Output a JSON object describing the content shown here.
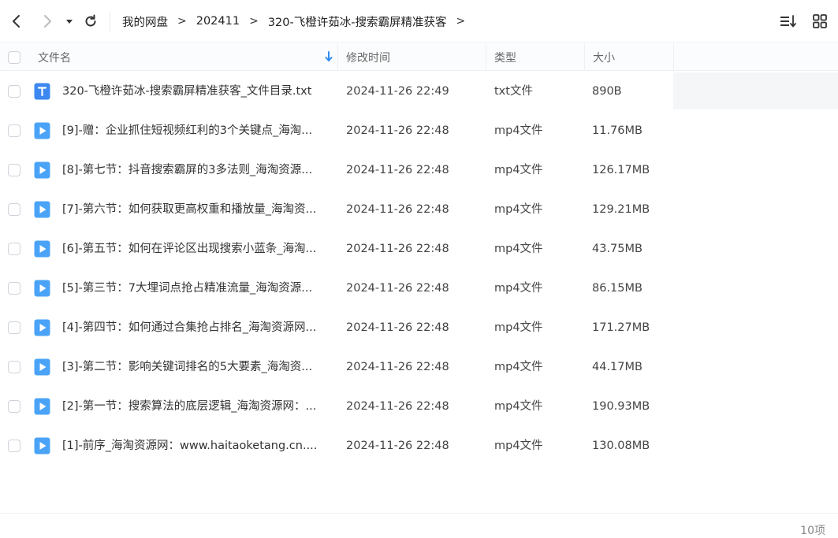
{
  "toolbar": {
    "breadcrumb": [
      "我的网盘",
      "202411",
      "320-飞橙许茹冰-搜索霸屏精准获客"
    ],
    "icons": [
      "back-arrow-icon",
      "forward-arrow-icon",
      "dropdown-caret-icon",
      "refresh-icon",
      "sort-list-icon",
      "grid-view-icon"
    ]
  },
  "header": {
    "name": "文件名",
    "time": "修改时间",
    "type": "类型",
    "size": "大小"
  },
  "files": [
    {
      "name": "320-飞橙许茹冰-搜索霸屏精准获客_文件目录.txt",
      "time": "2024-11-26 22:49",
      "type": "txt文件",
      "size": "890B",
      "icon": "txt-file-icon"
    },
    {
      "name": "[9]-赠：企业抓住短视频红利的3个关键点_海淘...",
      "time": "2024-11-26 22:48",
      "type": "mp4文件",
      "size": "11.76MB",
      "icon": "video-file-icon"
    },
    {
      "name": "[8]-第七节：抖音搜索霸屏的3多法则_海淘资源...",
      "time": "2024-11-26 22:48",
      "type": "mp4文件",
      "size": "126.17MB",
      "icon": "video-file-icon"
    },
    {
      "name": "[7]-第六节：如何获取更高权重和播放量_海淘资...",
      "time": "2024-11-26 22:48",
      "type": "mp4文件",
      "size": "129.21MB",
      "icon": "video-file-icon"
    },
    {
      "name": "[6]-第五节：如何在评论区出现搜索小蓝条_海淘...",
      "time": "2024-11-26 22:48",
      "type": "mp4文件",
      "size": "43.75MB",
      "icon": "video-file-icon"
    },
    {
      "name": "[5]-第三节：7大埋词点抢占精准流量_海淘资源...",
      "time": "2024-11-26 22:48",
      "type": "mp4文件",
      "size": "86.15MB",
      "icon": "video-file-icon"
    },
    {
      "name": "[4]-第四节：如何通过合集抢占排名_海淘资源网...",
      "time": "2024-11-26 22:48",
      "type": "mp4文件",
      "size": "171.27MB",
      "icon": "video-file-icon"
    },
    {
      "name": "[3]-第二节：影响关键词排名的5大要素_海淘资...",
      "time": "2024-11-26 22:48",
      "type": "mp4文件",
      "size": "44.17MB",
      "icon": "video-file-icon"
    },
    {
      "name": "[2]-第一节：搜索算法的底层逻辑_海淘资源网：...",
      "time": "2024-11-26 22:48",
      "type": "mp4文件",
      "size": "190.93MB",
      "icon": "video-file-icon"
    },
    {
      "name": "[1]-前序_海淘资源网：www.haitaoketang.cn....",
      "time": "2024-11-26 22:48",
      "type": "mp4文件",
      "size": "130.08MB",
      "icon": "video-file-icon"
    }
  ],
  "footer": {
    "count": "10项"
  },
  "colors": {
    "accent": "#2f8cf5",
    "txt_icon": "#3d87f0",
    "video_icon": "#4aa3f7"
  }
}
